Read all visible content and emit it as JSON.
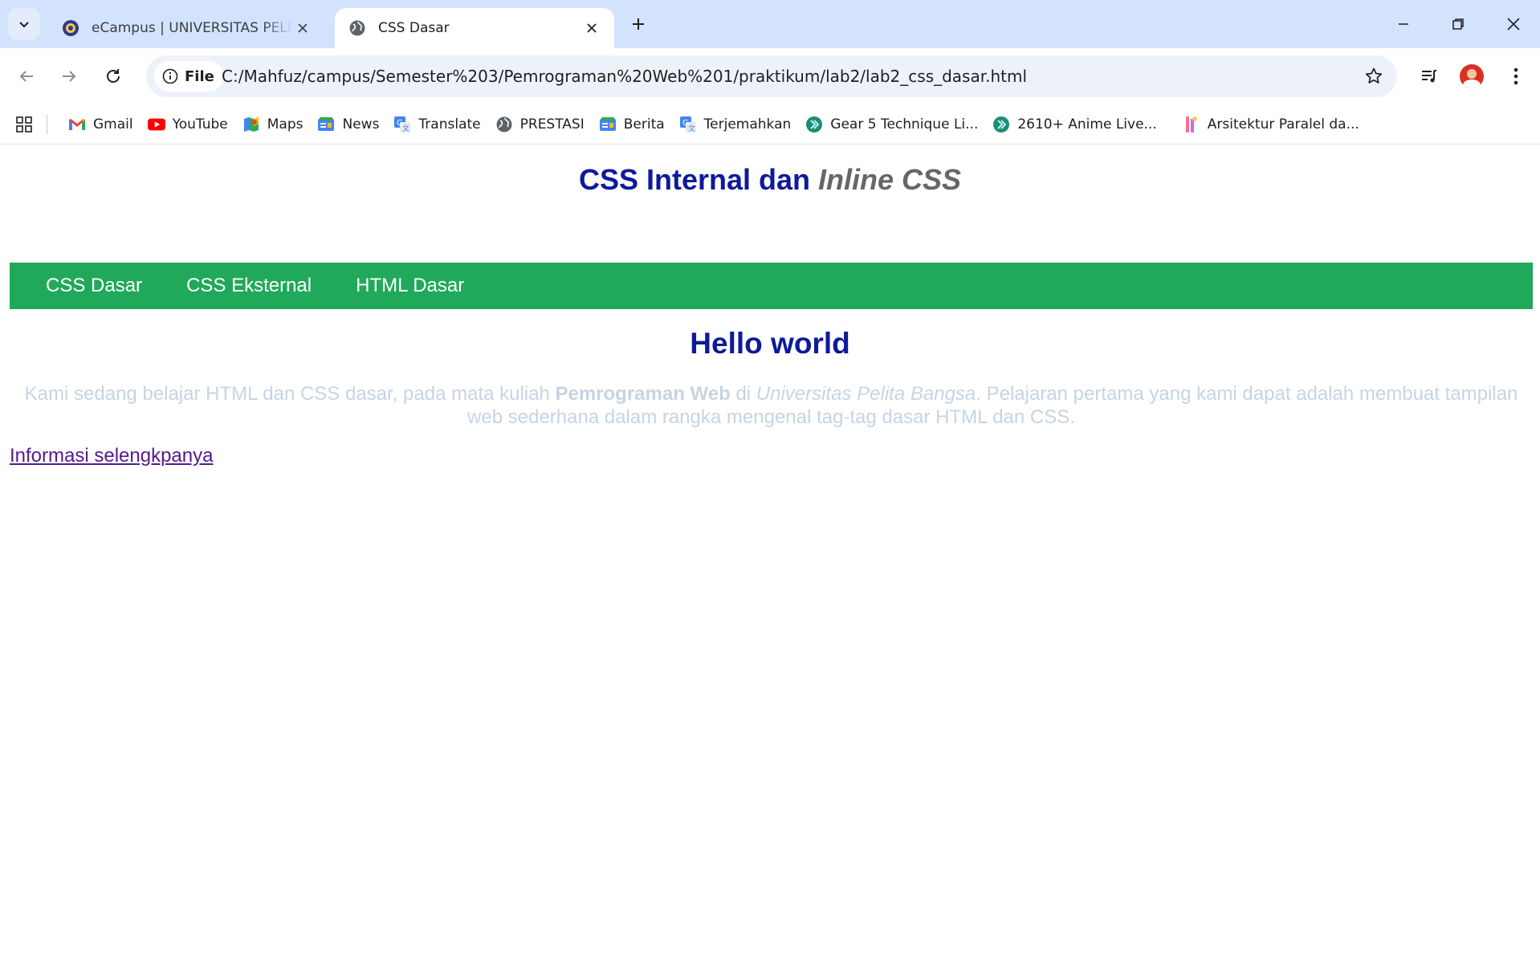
{
  "browser": {
    "tabs": [
      {
        "title": "eCampus | UNIVERSITAS PELITA BANGSA",
        "favicon": "university-logo-icon",
        "active": false
      },
      {
        "title": "CSS Dasar",
        "favicon": "globe-icon",
        "active": true
      }
    ],
    "omnibox": {
      "chip_label": "File",
      "url": "C:/Mahfuz/campus/Semester%203/Pemrograman%20Web%201/praktikum/lab2/lab2_css_dasar.html"
    },
    "bookmarks": [
      {
        "label": "Gmail",
        "icon": "gmail-icon"
      },
      {
        "label": "YouTube",
        "icon": "youtube-icon"
      },
      {
        "label": "Maps",
        "icon": "maps-icon"
      },
      {
        "label": "News",
        "icon": "news-icon"
      },
      {
        "label": "Translate",
        "icon": "translate-icon"
      },
      {
        "label": "PRESTASI",
        "icon": "globe-icon"
      },
      {
        "label": "Berita",
        "icon": "news-icon"
      },
      {
        "label": "Terjemahkan",
        "icon": "translate-icon"
      },
      {
        "label": "Gear 5 Technique Li...",
        "icon": "double-chevron-icon"
      },
      {
        "label": "2610+ Anime Live...",
        "icon": "double-chevron-icon"
      },
      {
        "label": "Arsitektur Paralel da...",
        "icon": "gradient-app-icon"
      }
    ]
  },
  "page": {
    "title_part1": "CSS Internal dan ",
    "title_part2": "Inline CSS",
    "nav": [
      "CSS Dasar",
      "CSS Eksternal",
      "HTML Dasar"
    ],
    "heading": "Hello world",
    "paragraph": {
      "text1": "Kami sedang belajar HTML dan CSS dasar, pada mata kuliah ",
      "bold": "Pemrograman Web",
      "text2": " di ",
      "italic": "Universitas Pelita Bangsa",
      "text3": ". Pelajaran pertama yang kami dapat adalah membuat tampilan web sederhana dalam rangka mengenal tag-tag dasar HTML dan CSS."
    },
    "link": "Informasi selengkpanya"
  },
  "colors": {
    "tabstrip": "#d3e3fd",
    "nav_bar": "#20a95a",
    "heading": "#0d1a9a",
    "paragraph": "#c6d4e3",
    "visited_link": "#551a8b"
  }
}
